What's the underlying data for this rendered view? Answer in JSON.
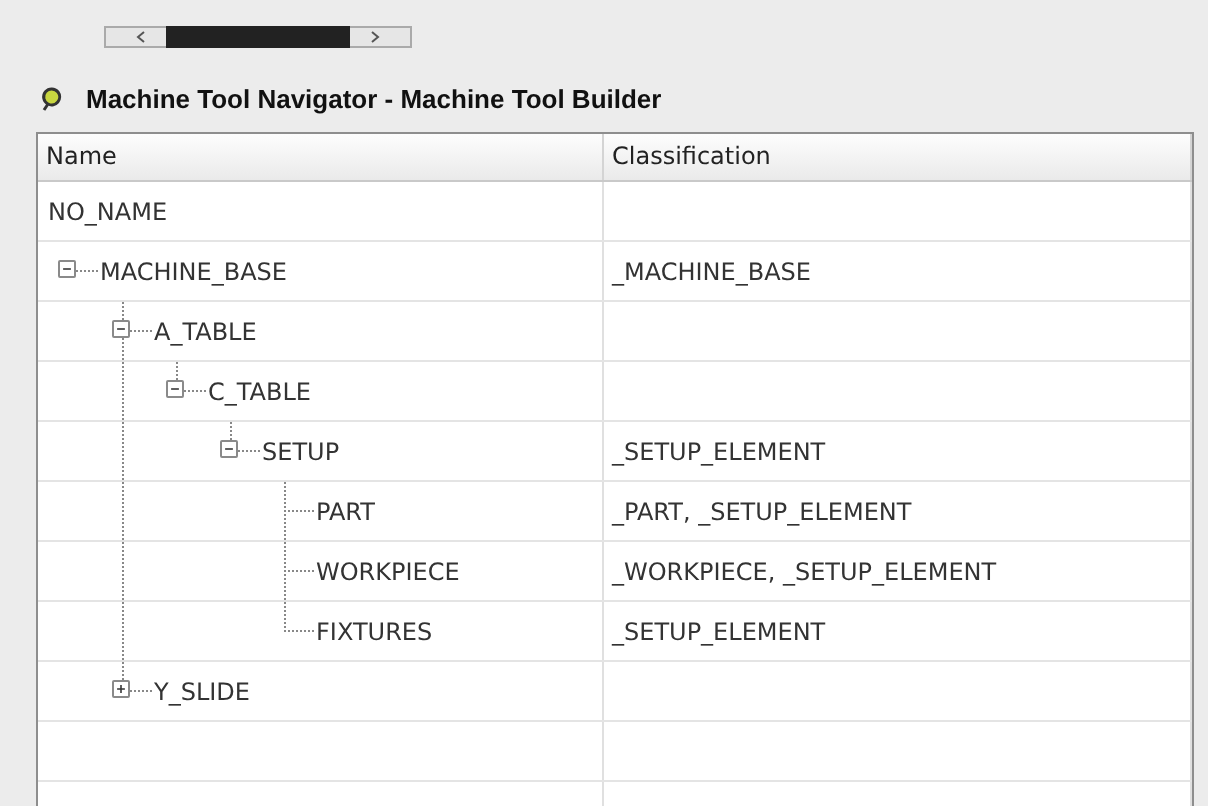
{
  "navigator": {
    "title": "Machine Tool Navigator - Machine Tool Builder"
  },
  "table": {
    "columns": [
      "Name",
      "Classification"
    ],
    "rows": [
      {
        "name": "NO_NAME"
      },
      {
        "name": "MACHINE_BASE",
        "classification": "_MACHINE_BASE",
        "expanded": true,
        "children": [
          {
            "name": "A_TABLE",
            "expanded": true,
            "children": [
              {
                "name": "C_TABLE",
                "expanded": true,
                "children": [
                  {
                    "name": "SETUP",
                    "classification": "_SETUP_ELEMENT",
                    "expanded": true,
                    "children": [
                      {
                        "name": "PART",
                        "classification": "_PART, _SETUP_ELEMENT"
                      },
                      {
                        "name": "WORKPIECE",
                        "classification": "_WORKPIECE, _SETUP_ELEMENT"
                      },
                      {
                        "name": "FIXTURES",
                        "classification": "_SETUP_ELEMENT"
                      }
                    ]
                  }
                ]
              }
            ]
          },
          {
            "name": "Y_SLIDE",
            "expanded": false
          }
        ]
      }
    ]
  }
}
